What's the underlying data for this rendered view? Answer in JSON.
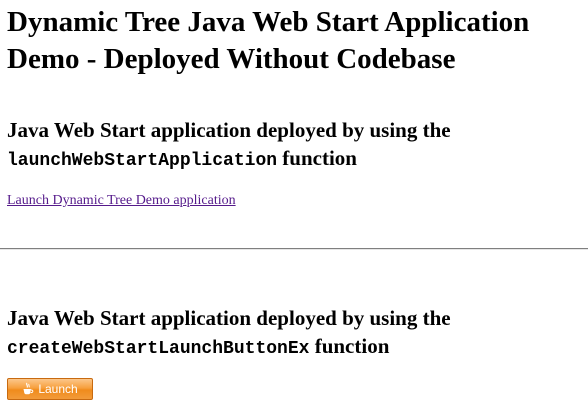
{
  "header": {
    "title_line1": "Dynamic Tree Java Web Start Application",
    "title_line2": "Demo - Deployed Without Codebase"
  },
  "section1": {
    "heading_text": "Java Web Start application deployed by using the",
    "heading_code": "launchWebStartApplication",
    "heading_suffix": " function",
    "link_label": "Launch Dynamic Tree Demo application"
  },
  "section2": {
    "heading_text": "Java Web Start application deployed by using the",
    "heading_code": "createWebStartLaunchButtonEx",
    "heading_suffix": " function",
    "button_label": "Launch",
    "button_icon": "java-coffee-cup-icon"
  },
  "colors": {
    "link": "#551a8b",
    "button_orange": "#f29b3a",
    "divider": "#7f7f7f"
  }
}
